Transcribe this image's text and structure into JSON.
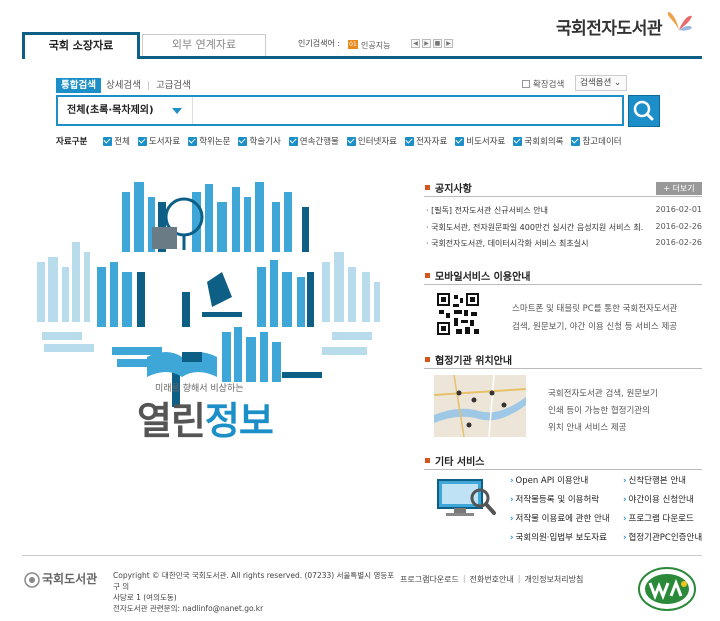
{
  "header": {
    "logo_text": "국회전자도서관",
    "tabs": [
      {
        "label": "국회 소장자료",
        "active": true
      },
      {
        "label": "외부 연계자료",
        "active": false
      }
    ],
    "hot_keywords_label": "인기검색어 :",
    "hot_keyword_rank": "01",
    "hot_keyword": "인공지능",
    "hot_nav": [
      "◀",
      "▶",
      "■",
      "▶"
    ]
  },
  "search": {
    "subtabs": [
      "통합검색",
      "상세검색",
      "고급검색"
    ],
    "extend_label": "확장검색",
    "options_label": "검색옵션",
    "scope_value": "전체(초록·목차제외)",
    "placeholder": "",
    "filter_label": "자료구분",
    "filters": [
      "전체",
      "도서자료",
      "학위논문",
      "학술기사",
      "연속간행물",
      "인터넷자료",
      "전자자료",
      "비도서자료",
      "국회회의록",
      "참고데이터"
    ]
  },
  "banner": {
    "tagline": "미래를 향해서 비상하는",
    "title_a": "열린",
    "title_b": "정보",
    "accent_color": "#1d8fc8"
  },
  "notices": {
    "title": "공지사항",
    "more_label": "+ 더보기",
    "items": [
      {
        "text": "· [필독] 전자도서관 신규서비스 안내",
        "date": "2016-02-01"
      },
      {
        "text": "· 국회도서관, 전자원문파일 400만건 실시간 음성지원 서비스 최...",
        "date": "2016-02-26"
      },
      {
        "text": "· 국회전자도서관, 데이터시각화 서비스 최초실시",
        "date": "2016-02-26"
      }
    ]
  },
  "mobile": {
    "title": "모바일서비스 이용안내",
    "desc_line1": "스마트폰 및 태블릿 PC를 통한 국회전자도서관",
    "desc_line2": "검색, 원문보기, 야간 이용 신청 등 서비스 제공"
  },
  "partners": {
    "title": "협정기관 위치안내",
    "desc_line1": "국회전자도서관 검색, 원문보기",
    "desc_line2": "인쇄 등이 가능한 협정기관의",
    "desc_line3": "위치 안내 서비스 제공"
  },
  "services": {
    "title": "기타 서비스",
    "items": [
      "Open API 이용안내",
      "신착단행본 안내",
      "저작물등록 및 이용허락",
      "야간이용 신청안내",
      "저작물 이용료에 관한 안내",
      "프로그램 다운로드",
      "국회의원·입법부 보도자료",
      "협정기관PC인증안내"
    ]
  },
  "footer": {
    "logo_text": "국회도서관",
    "copy_line1": "Copyright © 대한민국 국회도서관. All rights reserved. (07233) 서울특별시 영등포구 의",
    "copy_line2": "사당로 1 (여의도동)",
    "copy_line3": "전자도서관 관련문의: nadlinfo@nanet.go.kr",
    "links": [
      "프로그램다운로드",
      "전화번호안내",
      "개인정보처리방침"
    ]
  }
}
